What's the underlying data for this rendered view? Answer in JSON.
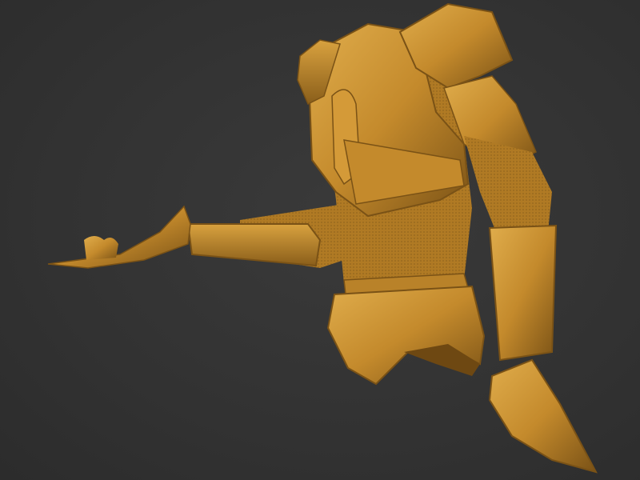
{
  "scene": {
    "subject": "armor-model",
    "colors": {
      "background": "#333333",
      "armor_base": "#c48a2c",
      "armor_light": "#e0ad4c",
      "armor_shadow": "#7a5216",
      "mail": "#b07a24"
    }
  }
}
